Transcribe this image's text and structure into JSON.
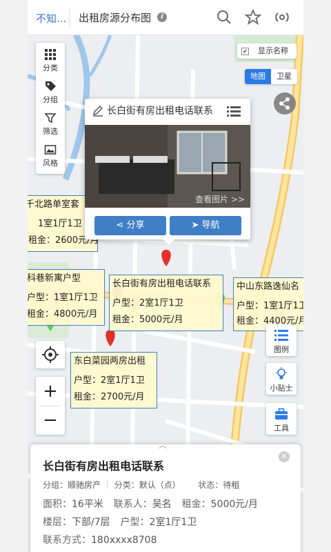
{
  "topbar": {
    "back_label": "不知...",
    "title": "出租房源分布图",
    "info_icon": "info-icon",
    "icons": [
      "search-icon",
      "star-icon",
      "broadcast-icon"
    ]
  },
  "left_tools": [
    {
      "label": "分类",
      "icon": "grid-icon"
    },
    {
      "label": "分组",
      "icon": "tag-icon"
    },
    {
      "label": "筛选",
      "icon": "filter-icon"
    },
    {
      "label": "风格",
      "icon": "image-icon"
    }
  ],
  "show_names": {
    "label": "显示名称",
    "checked": true
  },
  "map_type": {
    "map": "地图",
    "satellite": "卫星",
    "active": "地图"
  },
  "popup": {
    "title": "长白街有房出租电话联系",
    "see_pics": "查看图片 >>",
    "share": "分享",
    "navigate": "导航"
  },
  "map_labels": [
    {
      "title": "千北路单室套",
      "type": "1室1厅1卫",
      "rent": "2600元/月"
    },
    {
      "title": "科巷新寓户型",
      "type": "1室1厅1卫",
      "rent": "4800元/月"
    },
    {
      "title": "长白街有房出租电话联系",
      "type": "2室1厅1卫",
      "rent": "5000元/月"
    },
    {
      "title": "中山东路逸仙名",
      "type": "1室1厅1卫",
      "rent": "4400元/月"
    },
    {
      "title": "东白菜园两房出租",
      "type": "2室1厅1卫",
      "rent": "2700元/月"
    }
  ],
  "label_prefix": {
    "type": "户型：",
    "rent": "租金："
  },
  "right_tools": [
    {
      "label": "图例",
      "icon": "list-icon"
    },
    {
      "label": "小贴士",
      "icon": "lightbulb-icon"
    },
    {
      "label": "工具",
      "icon": "toolbox-icon"
    }
  ],
  "card": {
    "title": "长白街有房出租电话联系",
    "group_label": "分组：",
    "group_value": "顺驰房产",
    "category_label": "分类：",
    "category_value": "默认（点）",
    "status_label": "状态：",
    "status_value": "待租",
    "area_label": "面积：",
    "area_value": "16平米",
    "contact_label": "联系人：",
    "contact_value": "吴名",
    "rent_label": "租金：",
    "rent_value": "5000元/月",
    "floor_label": "楼层：",
    "floor_value": "下部/7层",
    "type_label": "户型：",
    "type_value": "2室1厅1卫",
    "phone_label": "联系方式：",
    "phone_value": "180xxxx8708"
  },
  "colors": {
    "accent": "#2c7be5",
    "label_bg": "#fff9cd",
    "label_border": "#3e7fc1",
    "pin_red": "#e0322b",
    "pin_green": "#5fc95a",
    "pin_purple": "#a03fd6"
  }
}
